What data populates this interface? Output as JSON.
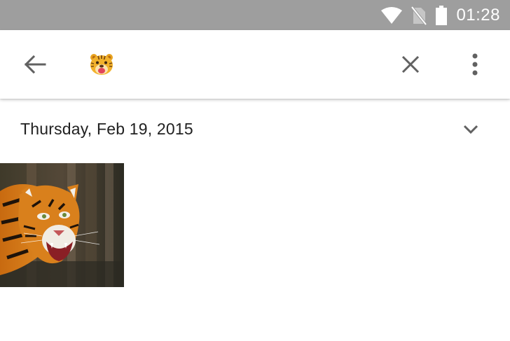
{
  "status_bar": {
    "time": "01:28",
    "icons": [
      "wifi-icon",
      "no-sim-icon",
      "battery-icon"
    ],
    "background": "#9e9e9e"
  },
  "app_bar": {
    "back_icon": "arrow-left-icon",
    "logo_icon": "tiger-face-icon",
    "close_icon": "close-icon",
    "menu_icon": "more-vert-icon"
  },
  "content": {
    "date_label": "Thursday, Feb 19, 2015",
    "expand_icon": "chevron-down-icon",
    "photos": [
      {
        "subject": "tiger-photo"
      }
    ]
  }
}
